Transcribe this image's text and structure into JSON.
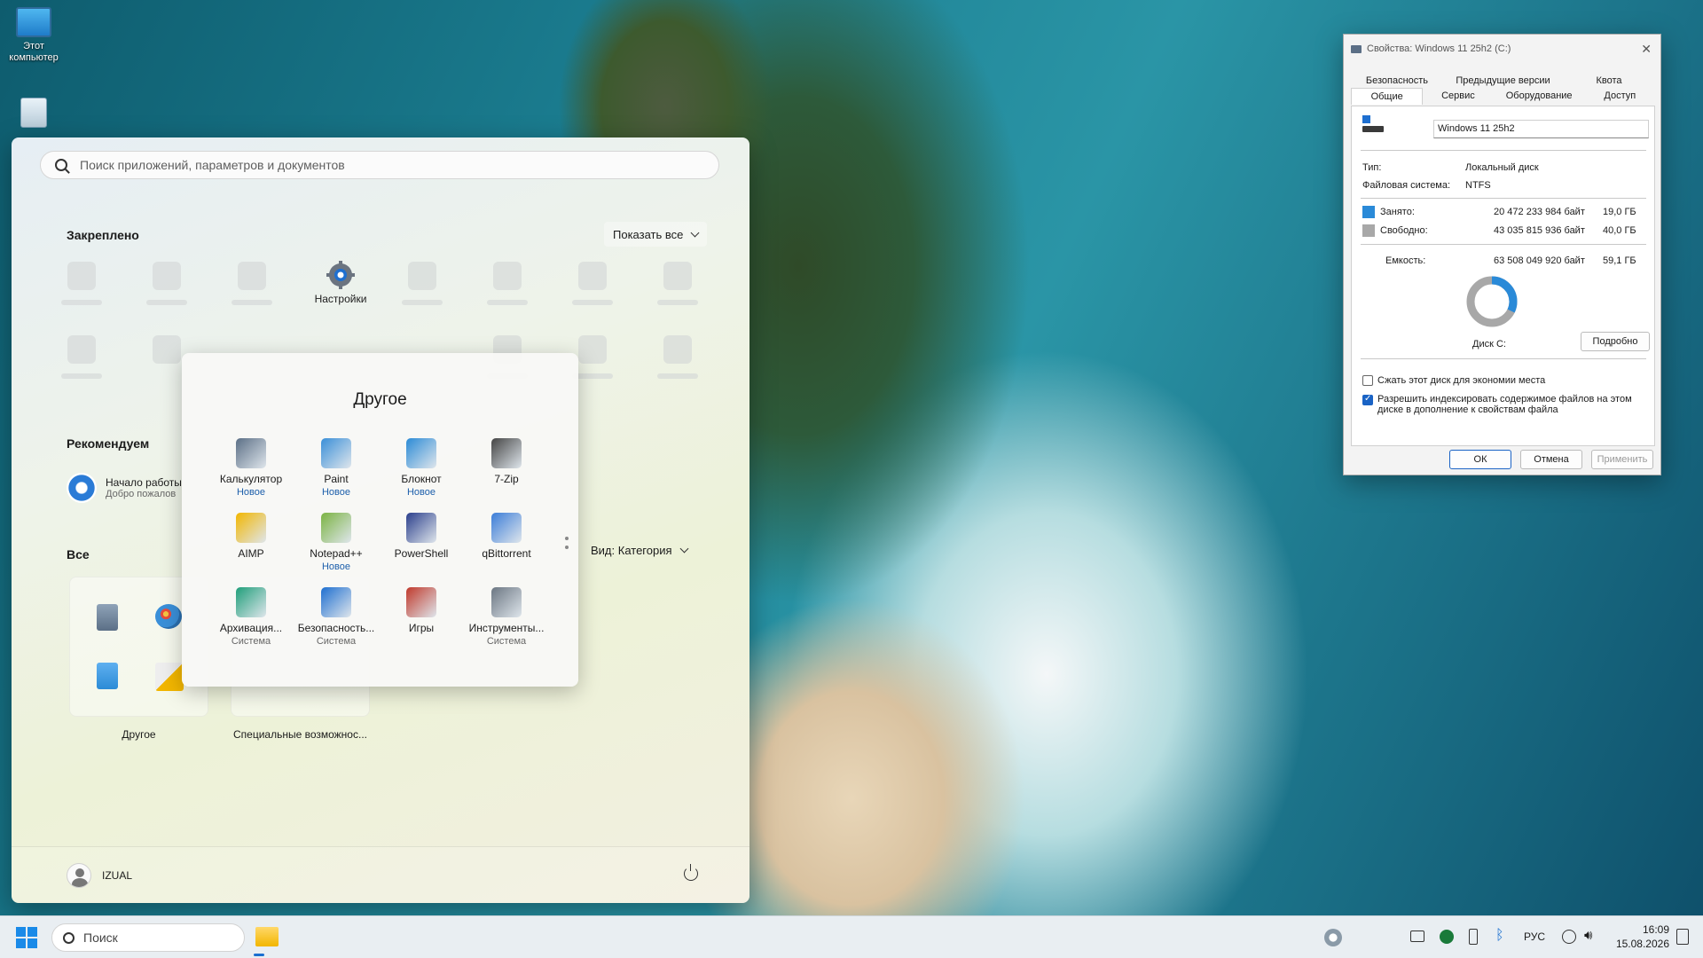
{
  "desktop": {
    "icons": [
      {
        "label": "Этот компьютер",
        "icon": "monitor-icon"
      },
      {
        "label": "",
        "icon": "recycle-bin-icon"
      }
    ]
  },
  "start_menu": {
    "search_placeholder": "Поиск приложений, параметров и документов",
    "pinned_title": "Закреплено",
    "show_all_label": "Показать все",
    "pinned_items": [
      {
        "label": "Настройки",
        "icon": "settings-gear-icon"
      }
    ],
    "recommended_title": "Рекомендуем",
    "recommended": {
      "title": "Начало работы",
      "subtitle": "Добро пожалов",
      "icon": "get-started-icon"
    },
    "all_title": "Все",
    "view_label": "Вид: Категория",
    "folders": [
      {
        "label": "Другое"
      },
      {
        "label": "Специальные возможнос..."
      }
    ],
    "user_name": "IZUAL"
  },
  "popup": {
    "title": "Другое",
    "apps": [
      {
        "name": "Калькулятор",
        "sub": "Новое",
        "sub_type": "new",
        "icon": "calculator-icon",
        "color": "#5b6f86"
      },
      {
        "name": "Paint",
        "sub": "Новое",
        "sub_type": "new",
        "icon": "paint-palette-icon",
        "color": "#3a8fd8"
      },
      {
        "name": "Блокнот",
        "sub": "Новое",
        "sub_type": "new",
        "icon": "notepad-icon",
        "color": "#2b8bd6"
      },
      {
        "name": "7-Zip",
        "sub": "",
        "sub_type": "",
        "icon": "7zip-icon",
        "color": "#444444"
      },
      {
        "name": "AIMP",
        "sub": "",
        "sub_type": "",
        "icon": "aimp-icon",
        "color": "#f2b600"
      },
      {
        "name": "Notepad++",
        "sub": "Новое",
        "sub_type": "new",
        "icon": "notepadpp-icon",
        "color": "#7bb342"
      },
      {
        "name": "PowerShell",
        "sub": "",
        "sub_type": "",
        "icon": "powershell-icon",
        "color": "#2b3f8c"
      },
      {
        "name": "qBittorrent",
        "sub": "",
        "sub_type": "",
        "icon": "qbittorrent-icon",
        "color": "#3b7dd8"
      },
      {
        "name": "Архивация...",
        "sub": "Система",
        "sub_type": "sys",
        "icon": "backup-cloud-icon",
        "color": "#1f9e7a"
      },
      {
        "name": "Безопасность...",
        "sub": "Система",
        "sub_type": "sys",
        "icon": "shield-icon",
        "color": "#1e6fd0"
      },
      {
        "name": "Игры",
        "sub": "",
        "sub_type": "",
        "icon": "cards-icon",
        "color": "#c0392b"
      },
      {
        "name": "Инструменты...",
        "sub": "Система",
        "sub_type": "sys",
        "icon": "tools-gear-icon",
        "color": "#6b7682"
      }
    ]
  },
  "properties": {
    "window_title": "Свойства: Windows 11 25h2 (C:)",
    "tabs_row1": [
      "Безопасность",
      "Предыдущие версии",
      "Квота"
    ],
    "tabs_row2": [
      "Общие",
      "Сервис",
      "Оборудование",
      "Доступ"
    ],
    "drive_name": "Windows 11 25h2",
    "type_label": "Тип:",
    "type_value": "Локальный диск",
    "fs_label": "Файловая система:",
    "fs_value": "NTFS",
    "used_label": "Занято:",
    "used_bytes": "20 472 233 984 байт",
    "used_gb": "19,0 ГБ",
    "free_label": "Свободно:",
    "free_bytes": "43 035 815 936 байт",
    "free_gb": "40,0 ГБ",
    "capacity_label": "Емкость:",
    "capacity_bytes": "63 508 049 920 байт",
    "capacity_gb": "59,1 ГБ",
    "used_fraction": 0.322,
    "used_color": "#2a8ad8",
    "free_color": "#a8a8a8",
    "disk_label": "Диск C:",
    "details_button": "Подробно",
    "compress_label": "Сжать этот диск для экономии места",
    "compress_checked": false,
    "index_label": "Разрешить индексировать содержимое файлов на этом диске в дополнение к свойствам файла",
    "index_checked": true,
    "ok_label": "ОК",
    "cancel_label": "Отмена",
    "apply_label": "Применить"
  },
  "taskbar": {
    "search_placeholder": "Поиск",
    "language": "РУС",
    "time": "16:09",
    "date": "15.08.2026"
  }
}
